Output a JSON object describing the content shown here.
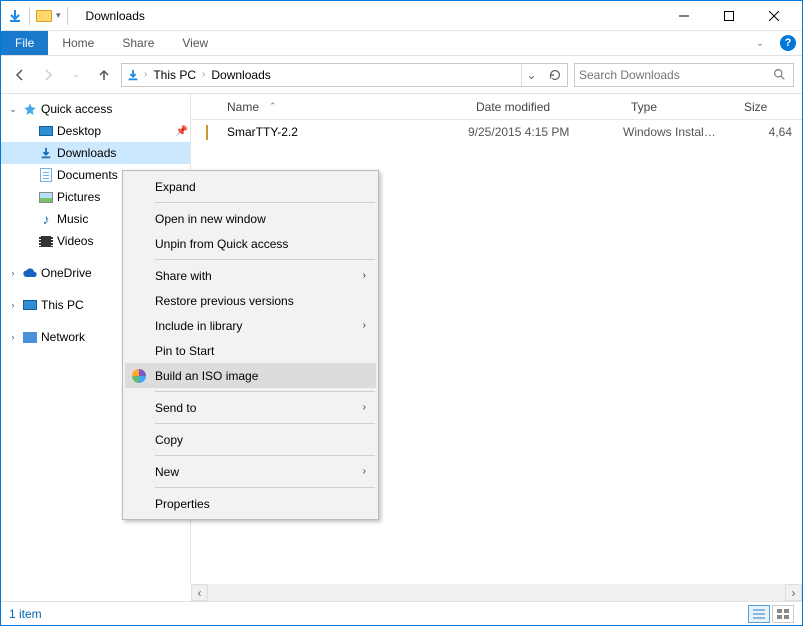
{
  "window": {
    "title": "Downloads"
  },
  "tabs": {
    "file": "File",
    "items": [
      "Home",
      "Share",
      "View"
    ]
  },
  "breadcrumb": {
    "root": "This PC",
    "path": "Downloads"
  },
  "search": {
    "placeholder": "Search Downloads"
  },
  "columns": {
    "name": "Name",
    "date": "Date modified",
    "type": "Type",
    "size": "Size"
  },
  "nav": {
    "quick": "Quick access",
    "items": [
      "Desktop",
      "Downloads",
      "Documents",
      "Pictures",
      "Music",
      "Videos"
    ],
    "onedrive": "OneDrive",
    "thispc": "This PC",
    "network": "Network"
  },
  "files": [
    {
      "name": "SmarTTY-2.2",
      "date": "9/25/2015 4:15 PM",
      "type": "Windows Installer ...",
      "size": "4,64"
    }
  ],
  "context": {
    "expand": "Expand",
    "openwin": "Open in new window",
    "unpin": "Unpin from Quick access",
    "share": "Share with",
    "restore": "Restore previous versions",
    "include": "Include in library",
    "pinstart": "Pin to Start",
    "buildiso": "Build an ISO image",
    "sendto": "Send to",
    "copy": "Copy",
    "new": "New",
    "props": "Properties"
  },
  "status": {
    "count": "1 item"
  }
}
